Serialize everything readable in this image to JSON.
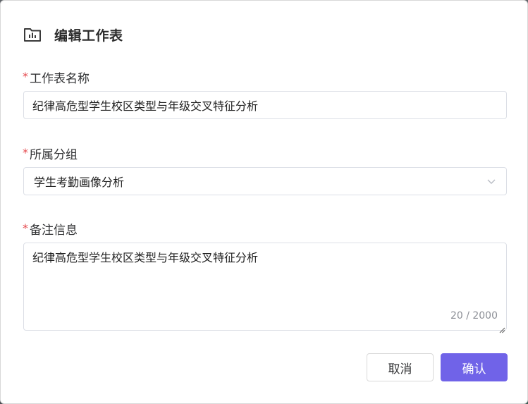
{
  "dialog": {
    "title": "编辑工作表",
    "icon": "folder-chart-icon"
  },
  "form": {
    "name": {
      "label": "工作表名称",
      "required_mark": "*",
      "value": "纪律高危型学生校区类型与年级交叉特征分析"
    },
    "group": {
      "label": "所属分组",
      "required_mark": "*",
      "selected": "学生考勤画像分析"
    },
    "remark": {
      "label": "备注信息",
      "required_mark": "*",
      "value": "纪律高危型学生校区类型与年级交叉特征分析",
      "counter": "20 / 2000"
    }
  },
  "buttons": {
    "cancel": "取消",
    "confirm": "确认"
  },
  "colors": {
    "accent": "#7063e8",
    "required": "#e5484d",
    "border": "#dcdfe6"
  }
}
